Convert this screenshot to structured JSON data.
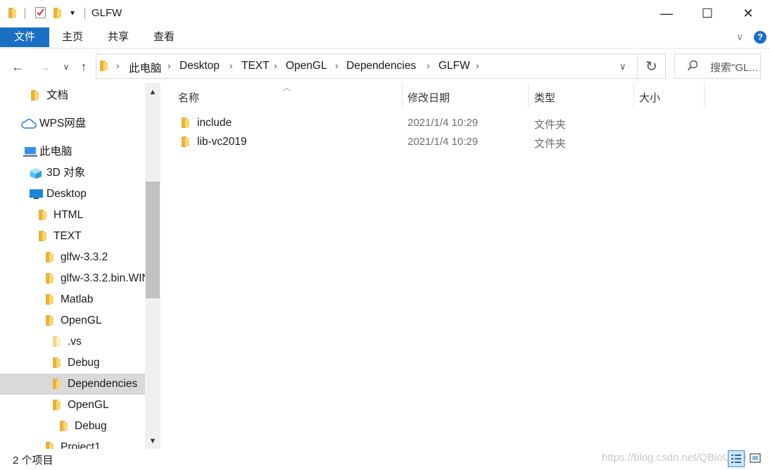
{
  "window": {
    "title": "GLFW",
    "qat_dropdown": "▾",
    "minimize": "—",
    "maximize": "☐",
    "close": "✕"
  },
  "ribbon": {
    "tabs": [
      "文件",
      "主页",
      "共享",
      "查看"
    ],
    "collapse": "∨",
    "help": "?"
  },
  "nav": {
    "back": "←",
    "forward": "→",
    "recent": "∨",
    "up": "↑",
    "breadcrumbs": [
      "此电脑",
      "Desktop",
      "TEXT",
      "OpenGL",
      "Dependencies",
      "GLFW"
    ],
    "address_dropdown": "∨",
    "refresh": "↻",
    "search_placeholder": "搜索\"GL..."
  },
  "sidebar": {
    "items": [
      {
        "label": "文档"
      },
      {
        "label": "WPS网盘"
      },
      {
        "label": "此电脑"
      },
      {
        "label": "3D 对象"
      },
      {
        "label": "Desktop"
      },
      {
        "label": "HTML"
      },
      {
        "label": "TEXT"
      },
      {
        "label": "glfw-3.3.2"
      },
      {
        "label": "glfw-3.3.2.bin.WIN"
      },
      {
        "label": "Matlab"
      },
      {
        "label": "OpenGL"
      },
      {
        "label": ".vs"
      },
      {
        "label": "Debug"
      },
      {
        "label": "Dependencies"
      },
      {
        "label": "OpenGL"
      },
      {
        "label": "Debug"
      },
      {
        "label": "Project1"
      }
    ]
  },
  "columns": {
    "name": "名称",
    "modified": "修改日期",
    "type": "类型",
    "size": "大小"
  },
  "files": [
    {
      "name": "include",
      "modified": "2021/1/4 10:29",
      "type": "文件夹"
    },
    {
      "name": "lib-vc2019",
      "modified": "2021/1/4 10:29",
      "type": "文件夹"
    }
  ],
  "status": {
    "item_count": "2 个项目",
    "watermark": "https://blog.csdn.net/QBioUIoU"
  },
  "colors": {
    "accent": "#1a6fc4",
    "folder": "#e9b23c",
    "selected": "#d9d9d9"
  }
}
